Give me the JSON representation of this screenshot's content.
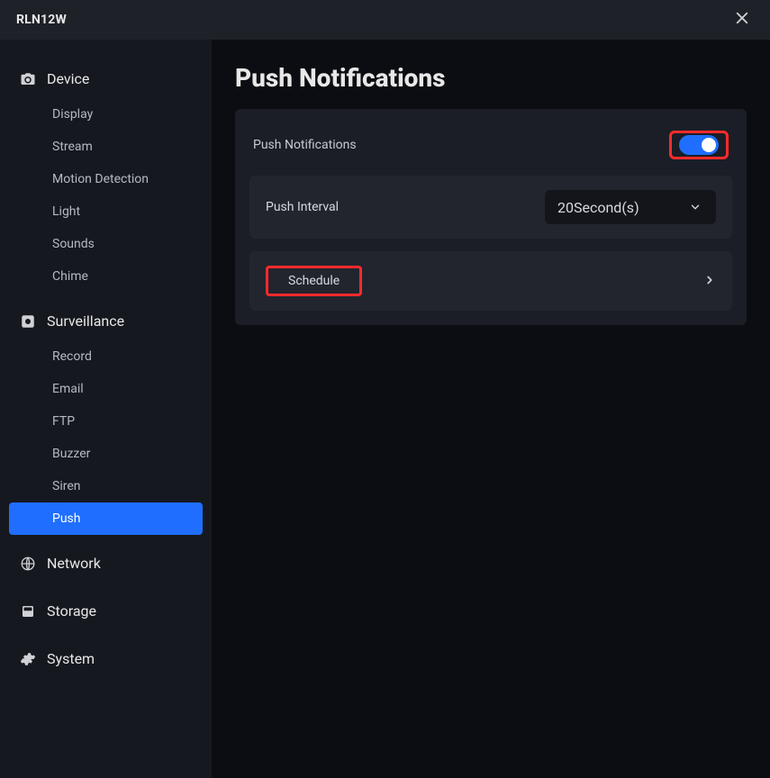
{
  "titlebar": {
    "title": "RLN12W"
  },
  "sidebar": {
    "groups": [
      {
        "key": "device",
        "label": "Device",
        "icon": "camera-icon",
        "items": [
          {
            "label": "Display",
            "key": "display"
          },
          {
            "label": "Stream",
            "key": "stream"
          },
          {
            "label": "Motion Detection",
            "key": "motion"
          },
          {
            "label": "Light",
            "key": "light"
          },
          {
            "label": "Sounds",
            "key": "sounds"
          },
          {
            "label": "Chime",
            "key": "chime"
          }
        ]
      },
      {
        "key": "surveillance",
        "label": "Surveillance",
        "icon": "record-icon",
        "items": [
          {
            "label": "Record",
            "key": "record"
          },
          {
            "label": "Email",
            "key": "email"
          },
          {
            "label": "FTP",
            "key": "ftp"
          },
          {
            "label": "Buzzer",
            "key": "buzzer"
          },
          {
            "label": "Siren",
            "key": "siren"
          },
          {
            "label": "Push",
            "key": "push",
            "active": true
          }
        ]
      },
      {
        "key": "network",
        "label": "Network",
        "icon": "globe-icon",
        "items": []
      },
      {
        "key": "storage",
        "label": "Storage",
        "icon": "disk-icon",
        "items": []
      },
      {
        "key": "system",
        "label": "System",
        "icon": "gear-icon",
        "items": []
      }
    ]
  },
  "page": {
    "title": "Push Notifications",
    "toggle_label": "Push Notifications",
    "toggle_on": true,
    "push_interval_label": "Push Interval",
    "push_interval_value": "20Second(s)",
    "schedule_label": "Schedule"
  },
  "colors": {
    "accent": "#1f6eff",
    "highlight": "#ff2b2b"
  }
}
